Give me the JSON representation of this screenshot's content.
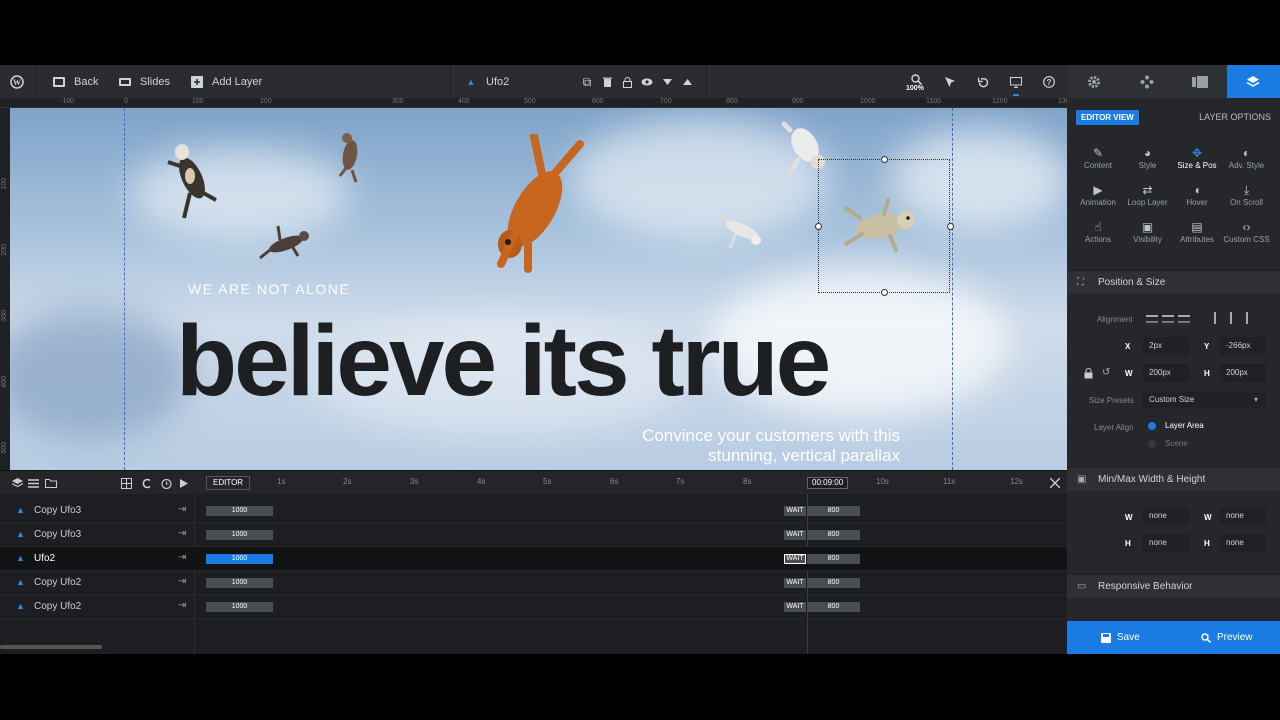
{
  "toolbar": {
    "back_label": "Back",
    "slides_label": "Slides",
    "add_layer_label": "Add Layer",
    "layer_name": "Ufo2",
    "zoom": "100%"
  },
  "ruler": {
    "top_labels": [
      "-100",
      "0",
      "100",
      "200",
      "300",
      "400",
      "500",
      "600",
      "700",
      "800",
      "900",
      "1000",
      "1100",
      "1200",
      "1300"
    ],
    "left_labels": [
      "100",
      "200",
      "300",
      "400",
      "500"
    ]
  },
  "canvas": {
    "eyebrow": "WE ARE NOT ALONE",
    "headline": "believe its true",
    "subtext": "Convince your customers with this stunning, vertical parallax"
  },
  "timeline": {
    "editor_label": "EDITOR",
    "ticks": [
      "1s",
      "2s",
      "3s",
      "4s",
      "5s",
      "6s",
      "7s",
      "8s",
      "10s",
      "11s",
      "12s"
    ],
    "current_time": "00:09:00",
    "rows": [
      {
        "name": "Copy Ufo3",
        "start": "1000",
        "wait": "WAIT",
        "end": "800",
        "active": false
      },
      {
        "name": "Copy Ufo3",
        "start": "1000",
        "wait": "WAIT",
        "end": "800",
        "active": false
      },
      {
        "name": "Ufo2",
        "start": "1000",
        "wait": "WAIT",
        "end": "800",
        "active": true
      },
      {
        "name": "Copy Ufo2",
        "start": "1000",
        "wait": "WAIT",
        "end": "800",
        "active": false
      },
      {
        "name": "Copy Ufo2",
        "start": "1000",
        "wait": "WAIT",
        "end": "800",
        "active": false
      }
    ]
  },
  "panel": {
    "editor_view": "EDITOR VIEW",
    "layer_options": "LAYER OPTIONS",
    "grid": [
      {
        "label": "Content",
        "icon": "pencil-icon"
      },
      {
        "label": "Style",
        "icon": "palette-icon"
      },
      {
        "label": "Size & Pos",
        "icon": "move-icon"
      },
      {
        "label": "Adv. Style",
        "icon": "drop-icon"
      },
      {
        "label": "Animation",
        "icon": "play-icon"
      },
      {
        "label": "Loop Layer",
        "icon": "loop-icon"
      },
      {
        "label": "Hover",
        "icon": "mouse-icon"
      },
      {
        "label": "On Scroll",
        "icon": "scroll-icon"
      },
      {
        "label": "Actions",
        "icon": "pointer-icon"
      },
      {
        "label": "Visibility",
        "icon": "visibility-icon"
      },
      {
        "label": "Attributes",
        "icon": "document-icon"
      },
      {
        "label": "Custom CSS",
        "icon": "code-icon"
      }
    ],
    "position_size": {
      "title": "Position & Size",
      "alignment_label": "Alignment",
      "x_label": "X",
      "x_value": "2px",
      "y_label": "Y",
      "y_value": "-266px",
      "w_label": "W",
      "w_value": "200px",
      "h_label": "H",
      "h_value": "200px",
      "size_presets_label": "Size Presets",
      "size_presets_value": "Custom Size",
      "layer_align_label": "Layer Align",
      "layer_area_label": "Layer Area",
      "scene_label": "Scene"
    },
    "minmax": {
      "title": "Min/Max Width & Height",
      "min_w": "none",
      "max_w": "none",
      "min_h": "none",
      "max_h": "none"
    },
    "responsive_title": "Responsive Behavior",
    "save_label": "Save",
    "preview_label": "Preview"
  },
  "colors": {
    "accent": "#1a7be2",
    "toolbar_bg": "#2a2c30",
    "panel_bg": "#25272a",
    "headline": "#1e1f22"
  }
}
